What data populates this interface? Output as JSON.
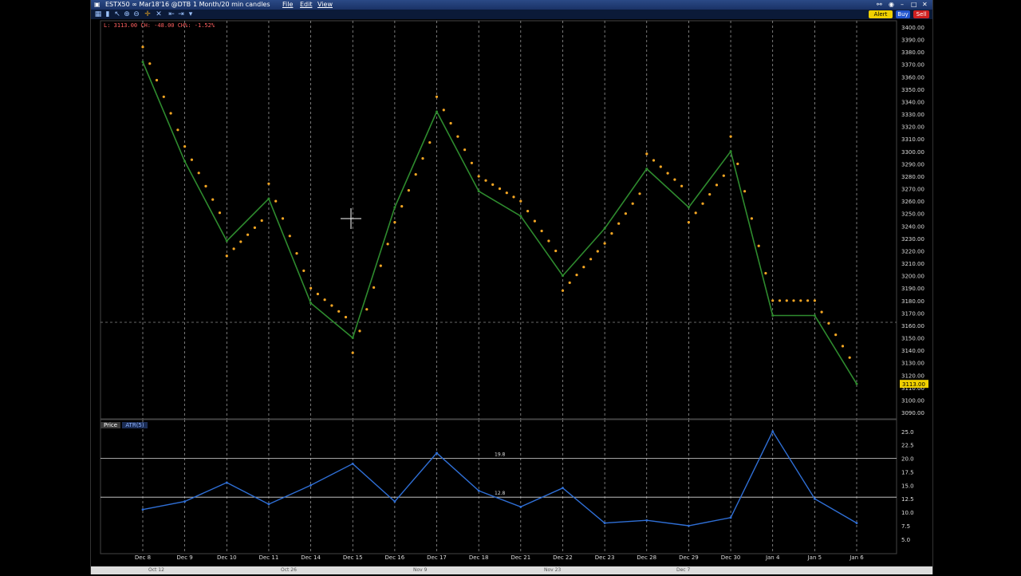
{
  "window": {
    "symbol": "ESTX50 ∞ Mar18'16 @DTB",
    "period": "1 Month/20 min candles",
    "menu": [
      "File",
      "Edit",
      "View"
    ],
    "buttons": {
      "alert": "Alert",
      "buy": "Buy",
      "sell": "Sell"
    }
  },
  "price_chart": {
    "info": "L: 3113.00  CH: -48.00  CH%: -1.52%",
    "last_price_label": "3113.00",
    "y_ticks": [
      "3400.00",
      "3390.00",
      "3380.00",
      "3370.00",
      "3360.00",
      "3350.00",
      "3340.00",
      "3330.00",
      "3320.00",
      "3310.00",
      "3300.00",
      "3290.00",
      "3280.00",
      "3270.00",
      "3260.00",
      "3250.00",
      "3240.00",
      "3230.00",
      "3220.00",
      "3210.00",
      "3200.00",
      "3190.00",
      "3180.00",
      "3170.00",
      "3160.00",
      "3150.00",
      "3140.00",
      "3130.00",
      "3120.00",
      "3110.00",
      "3100.00",
      "3090.00"
    ],
    "x_labels": [
      "Dec 8",
      "Dec 9",
      "Dec 10",
      "Dec 11",
      "Dec 14",
      "Dec 15",
      "Dec 16",
      "Dec 17",
      "Dec 18",
      "Dec 21",
      "Dec 22",
      "Dec 23",
      "Dec 28",
      "Dec 29",
      "Dec 30",
      "Jan 4",
      "Jan 5",
      "Jan 6"
    ]
  },
  "atr_panel": {
    "tab_price": "Price",
    "tab_atr": "ATR(5)",
    "y_ticks": [
      "25.0",
      "22.5",
      "20.0",
      "17.5",
      "15.0",
      "12.5",
      "10.0",
      "7.5",
      "5.0"
    ],
    "level_high": "19.8",
    "level_low": "12.8"
  },
  "bottom_axis": [
    "Oct 12",
    "Oct 26",
    "Nov 9",
    "Nov 23",
    "Dec 7"
  ],
  "colors": {
    "price_line": "#2e8b2e",
    "sar_dots": "#f5a623",
    "atr_line": "#2f6fd6",
    "alert_btn": "#f0d000",
    "buy_btn": "#2255cc",
    "sell_btn": "#d02020"
  },
  "chart_data": {
    "type": "line",
    "series": [
      {
        "name": "Price",
        "x": [
          "Dec 8",
          "Dec 9",
          "Dec 10",
          "Dec 11",
          "Dec 14",
          "Dec 15",
          "Dec 16",
          "Dec 17",
          "Dec 18",
          "Dec 21",
          "Dec 22",
          "Dec 23",
          "Dec 28",
          "Dec 29",
          "Dec 30",
          "Jan 4",
          "Jan 5",
          "Jan 6"
        ],
        "values": [
          3372,
          3292,
          3228,
          3262,
          3178,
          3150,
          3255,
          3332,
          3268,
          3248,
          3200,
          3238,
          3286,
          3255,
          3300,
          3168,
          3168,
          3113
        ]
      },
      {
        "name": "ATR(5)",
        "x": [
          "Dec 8",
          "Dec 9",
          "Dec 10",
          "Dec 11",
          "Dec 14",
          "Dec 15",
          "Dec 16",
          "Dec 17",
          "Dec 18",
          "Dec 21",
          "Dec 22",
          "Dec 23",
          "Dec 28",
          "Dec 29",
          "Dec 30",
          "Jan 4",
          "Jan 5",
          "Jan 6"
        ],
        "values": [
          10.5,
          12.0,
          15.5,
          11.5,
          15.0,
          19.0,
          12.0,
          21.0,
          14.0,
          11.0,
          14.5,
          8.0,
          8.5,
          7.5,
          9.0,
          25.0,
          12.5,
          8.0
        ]
      }
    ],
    "ylim": [
      3090,
      3400
    ],
    "atr_ylim": [
      3.5,
      26.0
    ]
  }
}
